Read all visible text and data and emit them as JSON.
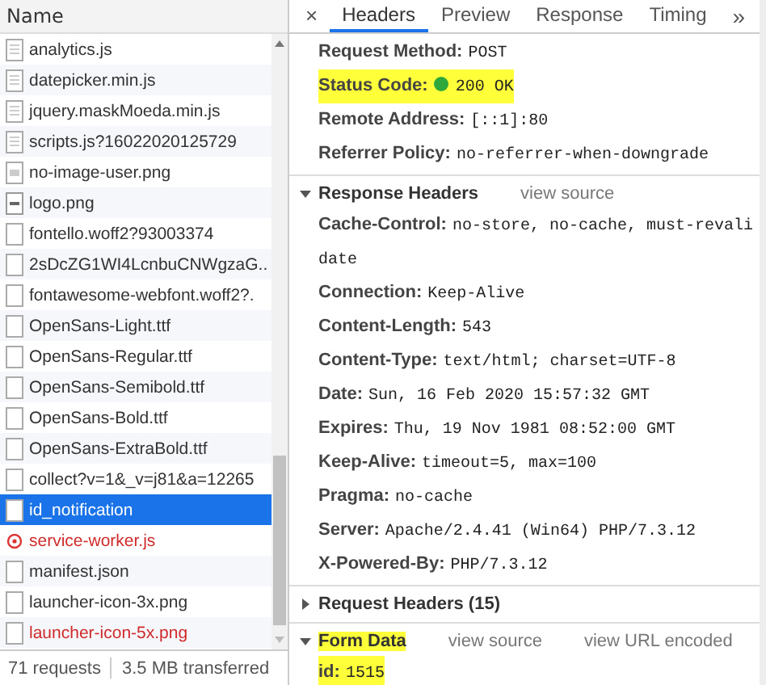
{
  "request_list": {
    "column_header": "Name",
    "rows": [
      {
        "name": "analytics.js",
        "kind": "script",
        "selected": false,
        "failed": false
      },
      {
        "name": "datepicker.min.js",
        "kind": "script",
        "selected": false,
        "failed": false
      },
      {
        "name": "jquery.maskMoeda.min.js",
        "kind": "script",
        "selected": false,
        "failed": false
      },
      {
        "name": "scripts.js?16022020125729",
        "kind": "script",
        "selected": false,
        "failed": false
      },
      {
        "name": "no-image-user.png",
        "kind": "image",
        "selected": false,
        "failed": false
      },
      {
        "name": "logo.png",
        "kind": "logo",
        "selected": false,
        "failed": false
      },
      {
        "name": "fontello.woff2?93003374",
        "kind": "blank",
        "selected": false,
        "failed": false
      },
      {
        "name": "2sDcZG1WI4LcnbuCNWgzaG..",
        "kind": "blank",
        "selected": false,
        "failed": false
      },
      {
        "name": "fontawesome-webfont.woff2?.",
        "kind": "blank",
        "selected": false,
        "failed": false
      },
      {
        "name": "OpenSans-Light.ttf",
        "kind": "blank",
        "selected": false,
        "failed": false
      },
      {
        "name": "OpenSans-Regular.ttf",
        "kind": "blank",
        "selected": false,
        "failed": false
      },
      {
        "name": "OpenSans-Semibold.ttf",
        "kind": "blank",
        "selected": false,
        "failed": false
      },
      {
        "name": "OpenSans-Bold.ttf",
        "kind": "blank",
        "selected": false,
        "failed": false
      },
      {
        "name": "OpenSans-ExtraBold.ttf",
        "kind": "blank",
        "selected": false,
        "failed": false
      },
      {
        "name": "collect?v=1&_v=j81&a=12265",
        "kind": "blank",
        "selected": false,
        "failed": false
      },
      {
        "name": "id_notification",
        "kind": "blank",
        "selected": true,
        "failed": false
      },
      {
        "name": "service-worker.js",
        "kind": "worker",
        "selected": false,
        "failed": true
      },
      {
        "name": "manifest.json",
        "kind": "blank",
        "selected": false,
        "failed": false
      },
      {
        "name": "launcher-icon-3x.png",
        "kind": "blank",
        "selected": false,
        "failed": false
      },
      {
        "name": "launcher-icon-5x.png",
        "kind": "blank",
        "selected": false,
        "failed": true
      }
    ]
  },
  "status_bar": {
    "requests": "71 requests",
    "transferred": "3.5 MB transferred"
  },
  "tabs": [
    {
      "label": "Headers",
      "selected": true
    },
    {
      "label": "Preview",
      "selected": false
    },
    {
      "label": "Response",
      "selected": false
    },
    {
      "label": "Timing",
      "selected": false
    }
  ],
  "close_icon": "×",
  "more_tabs": "»",
  "general": [
    {
      "key": "Request Method:",
      "value": "POST",
      "highlighted": false,
      "status_dot": false
    },
    {
      "key": "Status Code:",
      "value": "200 OK",
      "highlighted": true,
      "status_dot": true
    },
    {
      "key": "Remote Address:",
      "value": "[::1]:80",
      "highlighted": false,
      "status_dot": false
    },
    {
      "key": "Referrer Policy:",
      "value": "no-referrer-when-downgrade",
      "highlighted": false,
      "status_dot": false
    }
  ],
  "sections": [
    {
      "title": "Response Headers",
      "expanded": true,
      "highlighted": false,
      "links": [
        "view source"
      ],
      "items": [
        {
          "key": "Cache-Control:",
          "value": "no-store, no-cache, must-revalidate",
          "highlighted": false
        },
        {
          "key": "Connection:",
          "value": "Keep-Alive",
          "highlighted": false
        },
        {
          "key": "Content-Length:",
          "value": "543",
          "highlighted": false
        },
        {
          "key": "Content-Type:",
          "value": "text/html; charset=UTF-8",
          "highlighted": false
        },
        {
          "key": "Date:",
          "value": "Sun, 16 Feb 2020 15:57:32 GMT",
          "highlighted": false
        },
        {
          "key": "Expires:",
          "value": "Thu, 19 Nov 1981 08:52:00 GMT",
          "highlighted": false
        },
        {
          "key": "Keep-Alive:",
          "value": "timeout=5, max=100",
          "highlighted": false
        },
        {
          "key": "Pragma:",
          "value": "no-cache",
          "highlighted": false
        },
        {
          "key": "Server:",
          "value": "Apache/2.4.41 (Win64) PHP/7.3.12",
          "highlighted": false
        },
        {
          "key": "X-Powered-By:",
          "value": "PHP/7.3.12",
          "highlighted": false
        }
      ]
    },
    {
      "title": "Request Headers (15)",
      "expanded": false,
      "highlighted": false
    },
    {
      "title": "Form Data",
      "expanded": true,
      "highlighted": true,
      "links": [
        "view source",
        "view URL encoded"
      ],
      "items": [
        {
          "key": "id:",
          "value": "1515",
          "highlighted": true
        }
      ]
    }
  ]
}
